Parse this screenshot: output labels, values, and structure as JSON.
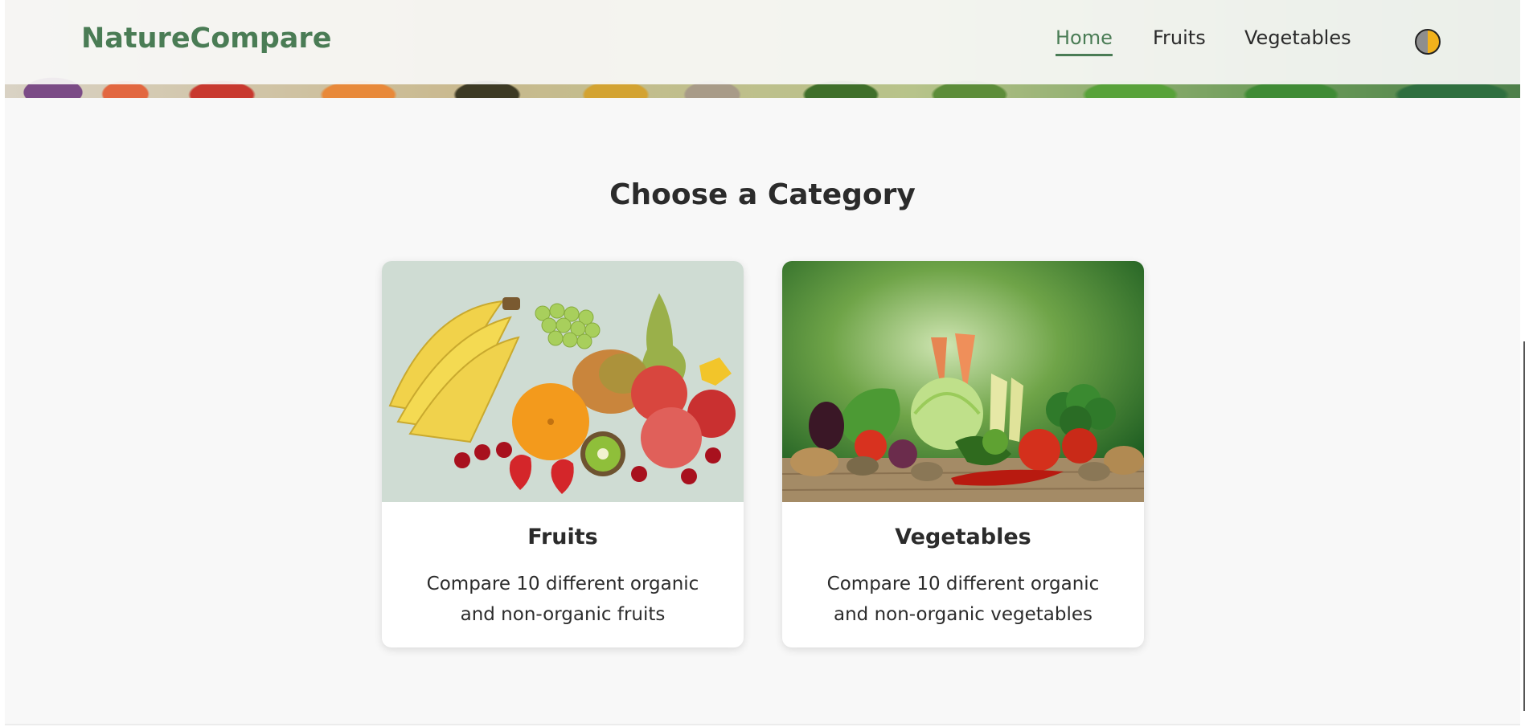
{
  "header": {
    "brand": "NatureCompare",
    "nav": {
      "home": "Home",
      "fruits": "Fruits",
      "vegetables": "Vegetables"
    },
    "theme_toggle_icon": "half-moon-theme-icon",
    "accent_color": "#4a7c55"
  },
  "main": {
    "heading": "Choose a Category",
    "cards": [
      {
        "title": "Fruits",
        "description": "Compare 10 different organic and non-organic fruits",
        "image": "fruit-assortment-image"
      },
      {
        "title": "Vegetables",
        "description": "Compare 10 different organic and non-organic vegetables",
        "image": "vegetable-assortment-image"
      }
    ]
  }
}
